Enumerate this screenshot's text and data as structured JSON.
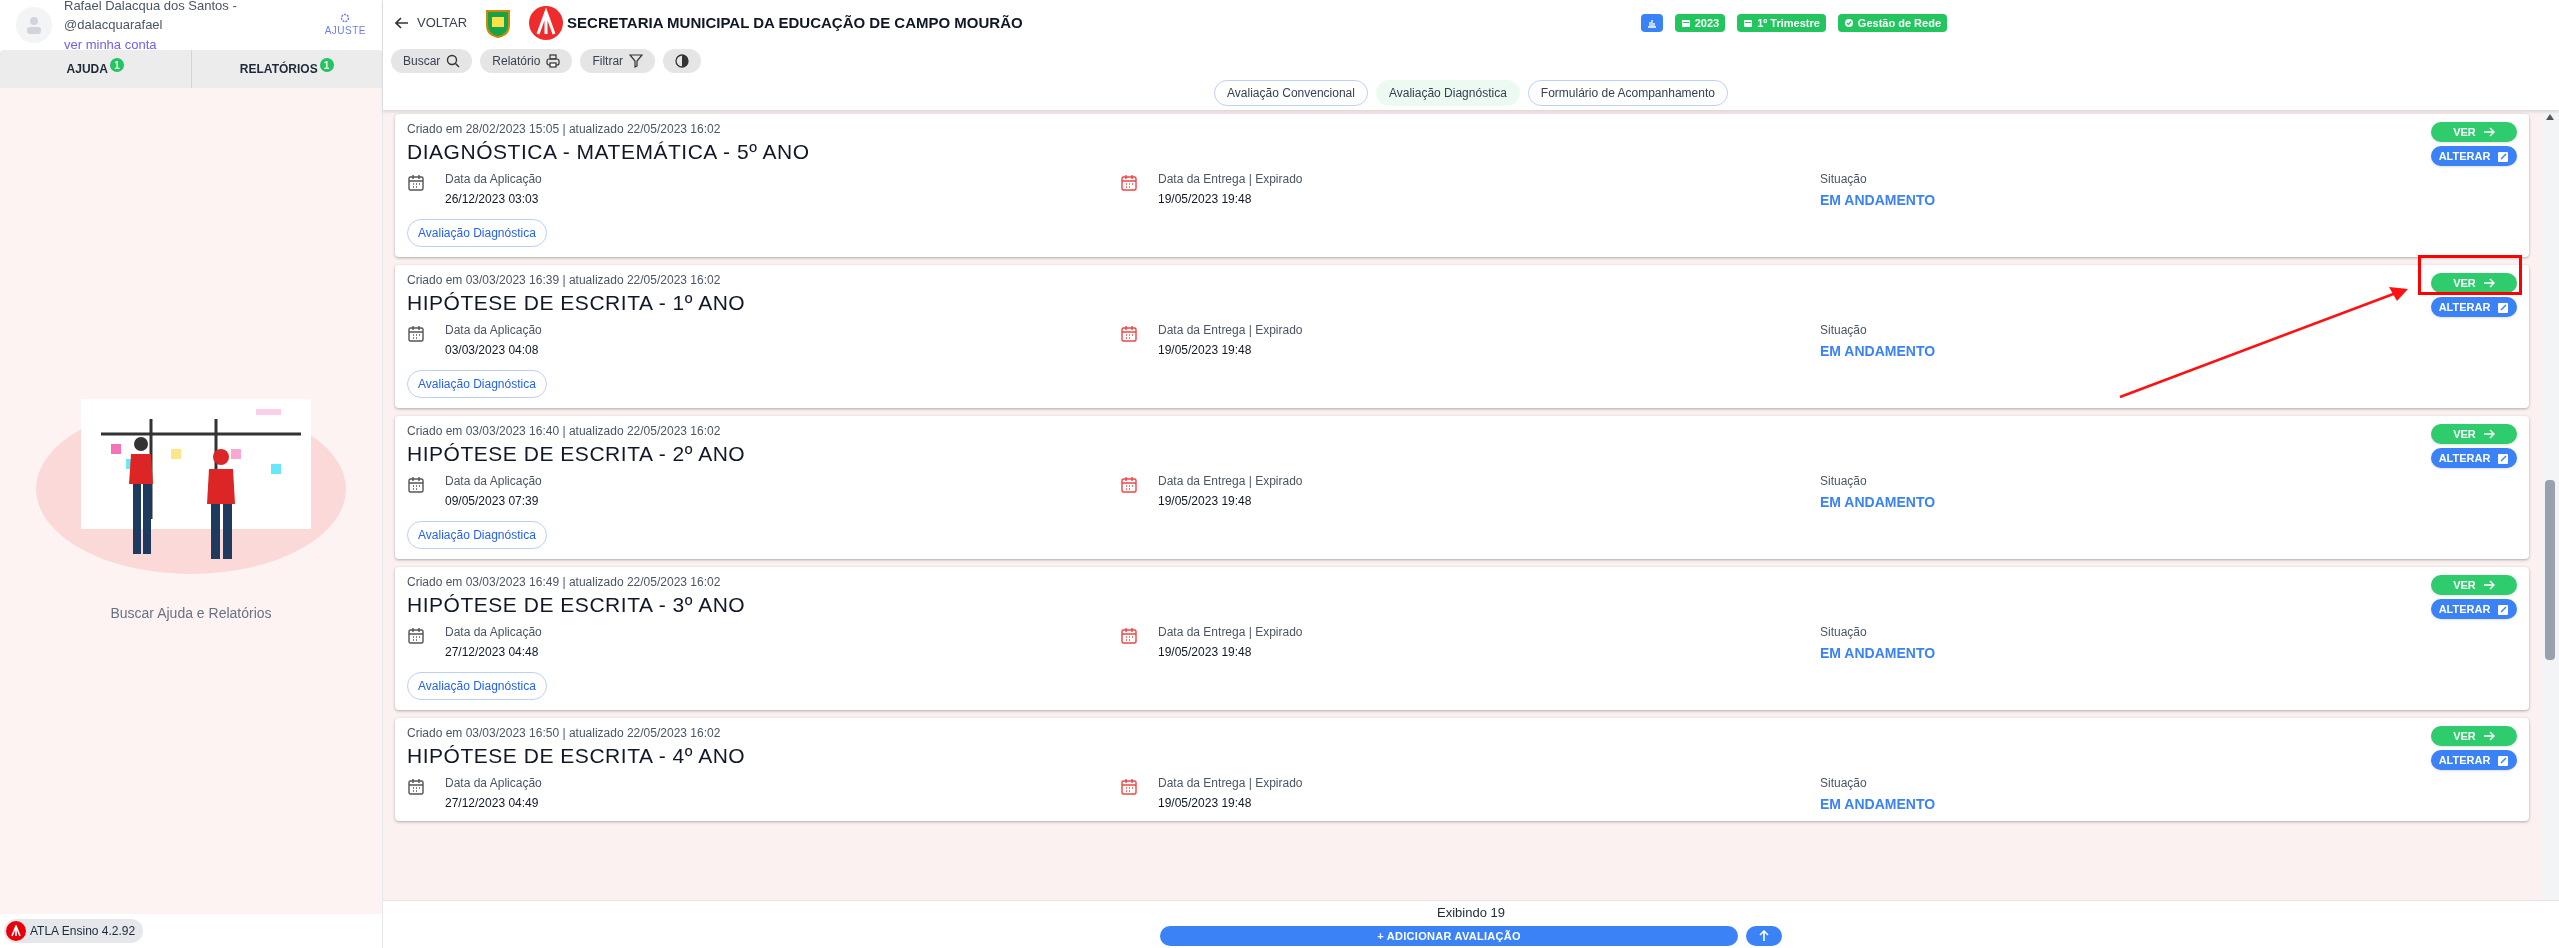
{
  "user": {
    "name": "Rafael Dalacqua dos Santos - @dalacquarafael",
    "account_link": "ver minha conta",
    "settings": "AJUSTE"
  },
  "sidebar_tabs": [
    {
      "label": "AJUDA",
      "badge": "1",
      "selected": false
    },
    {
      "label": "RELATÓRIOS",
      "badge": "1",
      "selected": false
    }
  ],
  "sidebar_empty": "Buscar Ajuda e Relatórios",
  "version": "ATLA Ensino 4.2.92",
  "header": {
    "back": "VOLTAR",
    "title": "SECRETARIA MUNICIPAL DA EDUCAÇÃO DE CAMPO MOURÃO",
    "chips": [
      {
        "kind": "chart"
      },
      {
        "kind": "calendar",
        "label": "2023"
      },
      {
        "kind": "calendar",
        "label": "1º Trimestre"
      },
      {
        "kind": "check",
        "label": "Gestão de Rede"
      }
    ]
  },
  "toolbar": [
    {
      "label": "Buscar",
      "kind": "search"
    },
    {
      "label": "Relatório",
      "kind": "print"
    },
    {
      "label": "Filtrar",
      "kind": "filter"
    },
    {
      "kind": "contrast"
    }
  ],
  "tabs": [
    {
      "label": "Avaliação Convencional",
      "selected": false
    },
    {
      "label": "Avaliação Diagnóstica",
      "selected": true
    },
    {
      "label": "Formulário de Acompanhamento",
      "selected": false
    }
  ],
  "cards": [
    {
      "meta": "Criado em 28/02/2023 15:05 | atualizado 22/05/2023 16:02",
      "title": "DIAGNÓSTICA - MATEMÁTICA - 5º ANO",
      "application_label": "Data da Aplicação",
      "application_date": "26/12/2023 03:03",
      "delivery_label": "Data da Entrega | Expirado",
      "delivery_date": "19/05/2023 19:48",
      "status_label": "Situação",
      "status": "EM ANDAMENTO",
      "tag": "Avaliação Diagnóstica",
      "view": "VER",
      "edit": "ALTERAR"
    },
    {
      "meta": "Criado em 03/03/2023 16:39 | atualizado 22/05/2023 16:02",
      "title": "HIPÓTESE DE ESCRITA - 1º ANO",
      "application_label": "Data da Aplicação",
      "application_date": "03/03/2023 04:08",
      "delivery_label": "Data da Entrega | Expirado",
      "delivery_date": "19/05/2023 19:48",
      "status_label": "Situação",
      "status": "EM ANDAMENTO",
      "tag": "Avaliação Diagnóstica",
      "view": "VER",
      "edit": "ALTERAR"
    },
    {
      "meta": "Criado em 03/03/2023 16:40 | atualizado 22/05/2023 16:02",
      "title": "HIPÓTESE DE ESCRITA - 2º ANO",
      "application_label": "Data da Aplicação",
      "application_date": "09/05/2023 07:39",
      "delivery_label": "Data da Entrega | Expirado",
      "delivery_date": "19/05/2023 19:48",
      "status_label": "Situação",
      "status": "EM ANDAMENTO",
      "tag": "Avaliação Diagnóstica",
      "view": "VER",
      "edit": "ALTERAR"
    },
    {
      "meta": "Criado em 03/03/2023 16:49 | atualizado 22/05/2023 16:02",
      "title": "HIPÓTESE DE ESCRITA - 3º ANO",
      "application_label": "Data da Aplicação",
      "application_date": "27/12/2023 04:48",
      "delivery_label": "Data da Entrega | Expirado",
      "delivery_date": "19/05/2023 19:48",
      "status_label": "Situação",
      "status": "EM ANDAMENTO",
      "tag": "Avaliação Diagnóstica",
      "view": "VER",
      "edit": "ALTERAR"
    },
    {
      "meta": "Criado em 03/03/2023 16:50 | atualizado 22/05/2023 16:02",
      "title": "HIPÓTESE DE ESCRITA - 4º ANO",
      "application_label": "Data da Aplicação",
      "application_date": "27/12/2023 04:49",
      "delivery_label": "Data da Entrega | Expirado",
      "delivery_date": "19/05/2023 19:48",
      "status_label": "Situação",
      "status": "EM ANDAMENTO",
      "view": "VER",
      "edit": "ALTERAR"
    }
  ],
  "footer": {
    "count": "Exibindo 19",
    "add": "+ ADICIONAR AVALIAÇÃO"
  }
}
